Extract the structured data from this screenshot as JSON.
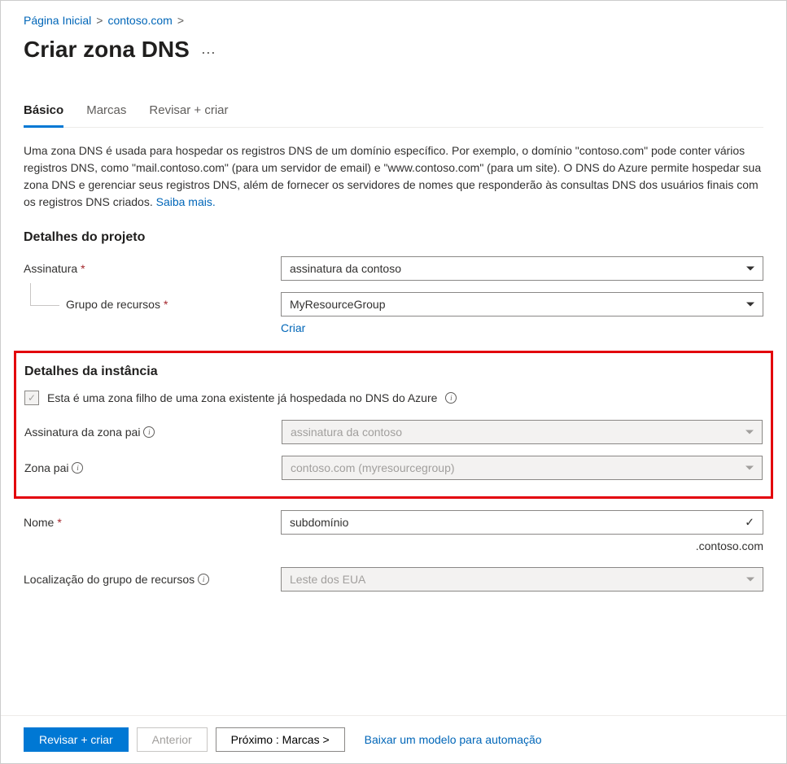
{
  "breadcrumb": {
    "home": "Página Inicial",
    "parent": "contoso.com"
  },
  "page_title": "Criar zona DNS",
  "tabs": {
    "basic": "Básico",
    "tags": "Marcas",
    "review": "Revisar + criar"
  },
  "description": {
    "text": "Uma zona DNS é usada para hospedar os registros DNS de um domínio específico. Por exemplo, o domínio \"contoso.com\" pode conter vários registros DNS, como \"mail.contoso.com\" (para um servidor de email) e \"www.contoso.com\" (para um site). O DNS do Azure permite hospedar sua zona DNS e gerenciar seus registros DNS, além de fornecer os servidores de nomes que responderão às consultas DNS dos usuários finais com os registros DNS criados. ",
    "learn_more": "Saiba mais."
  },
  "project_details": {
    "heading": "Detalhes do projeto",
    "subscription_label": "Assinatura",
    "subscription_value": "assinatura da contoso",
    "resource_group_label": "Grupo de recursos",
    "resource_group_value": "MyResourceGroup",
    "create_new": "Criar"
  },
  "instance_details": {
    "heading": "Detalhes da instância",
    "child_zone_checkbox": "Esta é uma zona filho de uma zona existente já hospedada no DNS do Azure",
    "parent_subscription_label": "Assinatura da zona pai",
    "parent_subscription_value": "assinatura da contoso",
    "parent_zone_label": "Zona pai",
    "parent_zone_value": "contoso.com (myresourcegroup)",
    "name_label": "Nome",
    "name_value": "subdomínio",
    "name_suffix": ".contoso.com",
    "location_label": "Localização do grupo de recursos",
    "location_value": "Leste dos EUA"
  },
  "footer": {
    "review_create": "Revisar + criar",
    "previous": "Anterior",
    "next": "Próximo : Marcas >",
    "download_template": "Baixar um modelo para automação"
  }
}
